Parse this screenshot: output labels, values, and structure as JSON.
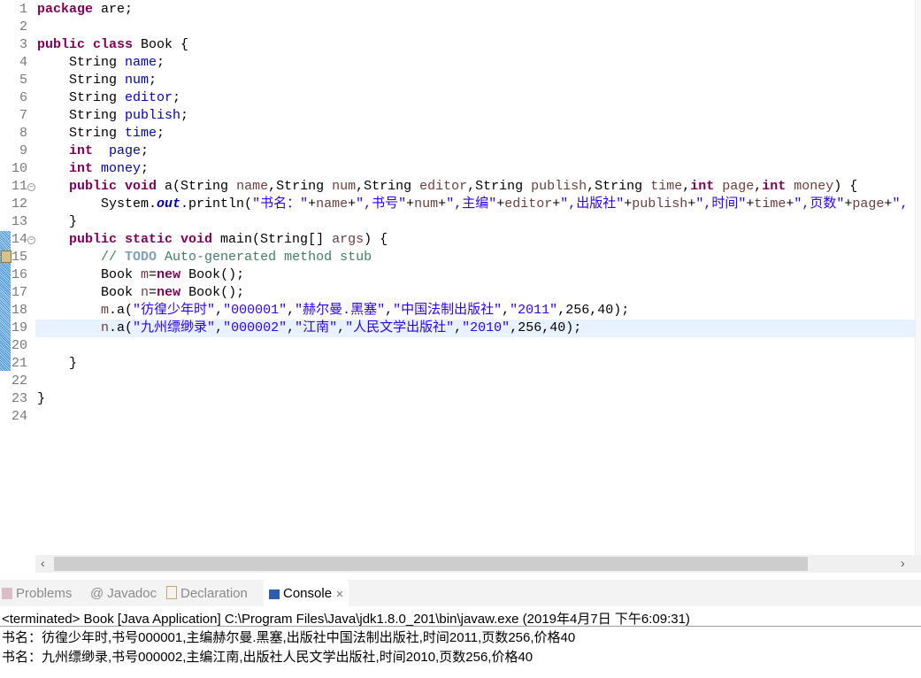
{
  "editor": {
    "lines": [
      [
        [
          "k",
          "package"
        ],
        [
          "",
          "are;"
        ]
      ],
      [],
      [
        [
          "k",
          "public class"
        ],
        [
          "",
          "Book {"
        ]
      ],
      [
        [
          "",
          "    String "
        ],
        [
          "f",
          "name"
        ],
        [
          "",
          ";"
        ]
      ],
      [
        [
          "",
          "    String "
        ],
        [
          "f",
          "num"
        ],
        [
          "",
          ";"
        ]
      ],
      [
        [
          "",
          "    String "
        ],
        [
          "f",
          "editor"
        ],
        [
          "",
          ";"
        ]
      ],
      [
        [
          "",
          "    String "
        ],
        [
          "f",
          "publish"
        ],
        [
          "",
          ";"
        ]
      ],
      [
        [
          "",
          "    String "
        ],
        [
          "f",
          "time"
        ],
        [
          "",
          ";"
        ]
      ],
      [
        [
          "",
          "    "
        ],
        [
          "k",
          "int"
        ],
        [
          "",
          ""
        ],
        [
          "f",
          " page"
        ],
        [
          "",
          ";"
        ]
      ],
      [
        [
          "",
          "    "
        ],
        [
          "k",
          "int"
        ],
        [
          "f",
          " money"
        ],
        [
          "",
          ";"
        ]
      ],
      [
        [
          "",
          "    "
        ],
        [
          "k",
          "public void"
        ],
        [
          "",
          " a(String "
        ],
        [
          "v",
          "name"
        ],
        [
          "",
          ",String "
        ],
        [
          "v",
          "num"
        ],
        [
          "",
          ",String "
        ],
        [
          "v",
          "editor"
        ],
        [
          "",
          ",String "
        ],
        [
          "v",
          "publish"
        ],
        [
          "",
          ",String "
        ],
        [
          "v",
          "time"
        ],
        [
          "",
          ","
        ],
        [
          "k",
          "int"
        ],
        [
          "v",
          " page"
        ],
        [
          "",
          ","
        ],
        [
          "k",
          "int"
        ],
        [
          "v",
          " money"
        ],
        [
          "",
          ") {"
        ]
      ],
      [
        [
          "",
          "        System."
        ],
        [
          "fi",
          "out"
        ],
        [
          "",
          ".println("
        ],
        [
          "s",
          "\"书名：\""
        ],
        [
          "",
          "+"
        ],
        [
          "v",
          "name"
        ],
        [
          "",
          "+"
        ],
        [
          "s",
          "\",书号\""
        ],
        [
          "",
          "+"
        ],
        [
          "v",
          "num"
        ],
        [
          "",
          "+"
        ],
        [
          "s",
          "\",主编\""
        ],
        [
          "",
          "+"
        ],
        [
          "v",
          "editor"
        ],
        [
          "",
          "+"
        ],
        [
          "s",
          "\",出版社\""
        ],
        [
          "",
          "+"
        ],
        [
          "v",
          "publish"
        ],
        [
          "",
          "+"
        ],
        [
          "s",
          "\",时间\""
        ],
        [
          "",
          "+"
        ],
        [
          "v",
          "time"
        ],
        [
          "",
          "+"
        ],
        [
          "s",
          "\",页数\""
        ],
        [
          "",
          "+"
        ],
        [
          "v",
          "page"
        ],
        [
          "",
          "+"
        ],
        [
          "s",
          "\","
        ]
      ],
      [
        [
          "",
          "    }"
        ]
      ],
      [
        [
          "",
          "    "
        ],
        [
          "k",
          "public static void"
        ],
        [
          "",
          ""
        ],
        [
          "",
          "main(String[] "
        ],
        [
          "v",
          "args"
        ],
        [
          "",
          ") {"
        ]
      ],
      [
        [
          "c",
          "        // "
        ],
        [
          "t",
          "TODO"
        ],
        [
          "c",
          " Auto-generated method stub"
        ]
      ],
      [
        [
          "",
          "        Book "
        ],
        [
          "v",
          "m"
        ],
        [
          "",
          "="
        ],
        [
          "k",
          "new"
        ],
        [
          "",
          " Book();"
        ]
      ],
      [
        [
          "",
          "        Book "
        ],
        [
          "v",
          "n"
        ],
        [
          "",
          "="
        ],
        [
          "k",
          "new"
        ],
        [
          "",
          " Book();"
        ]
      ],
      [
        [
          "",
          "        "
        ],
        [
          "v",
          "m"
        ],
        [
          "",
          ".a("
        ],
        [
          "s",
          "\"彷徨少年时\""
        ],
        [
          "",
          ","
        ],
        [
          "s",
          "\"000001\""
        ],
        [
          "",
          ","
        ],
        [
          "s",
          "\"赫尔曼.黑塞\""
        ],
        [
          "",
          ","
        ],
        [
          "s",
          "\"中国法制出版社\""
        ],
        [
          "",
          ","
        ],
        [
          "s",
          "\"2011\""
        ],
        [
          "",
          ",256,40);"
        ]
      ],
      [
        [
          "",
          "        "
        ],
        [
          "v",
          "n"
        ],
        [
          "",
          ".a("
        ],
        [
          "s",
          "\"九州缥缈录\""
        ],
        [
          "",
          ","
        ],
        [
          "s",
          "\"000002\""
        ],
        [
          "",
          ","
        ],
        [
          "s",
          "\"江南\""
        ],
        [
          "",
          ","
        ],
        [
          "s",
          "\"人民文学出版社\""
        ],
        [
          "",
          ","
        ],
        [
          "s",
          "\"2010\""
        ],
        [
          "",
          ",256,40);"
        ]
      ],
      [],
      [
        [
          "",
          "    }"
        ]
      ],
      [],
      [
        [
          "",
          "}"
        ]
      ],
      []
    ],
    "folds": [
      11,
      14
    ],
    "current_line": 19
  },
  "tabs": [
    {
      "label": "Problems",
      "icon": "problems-icon"
    },
    {
      "label": "Javadoc",
      "icon": "at-icon"
    },
    {
      "label": "Declaration",
      "icon": "declaration-icon"
    },
    {
      "label": "Console",
      "icon": "console-icon",
      "close": "✕"
    }
  ],
  "console": {
    "header": "<terminated> Book [Java Application] C:\\Program Files\\Java\\jdk1.8.0_201\\bin\\javaw.exe (2019年4月7日 下午6:09:31)",
    "output": [
      "书名：彷徨少年时,书号000001,主编赫尔曼.黑塞,出版社中国法制出版社,时间2011,页数256,价格40",
      "书名：九州缥缈录,书号000002,主编江南,出版社人民文学出版社,时间2010,页数256,价格40"
    ]
  }
}
